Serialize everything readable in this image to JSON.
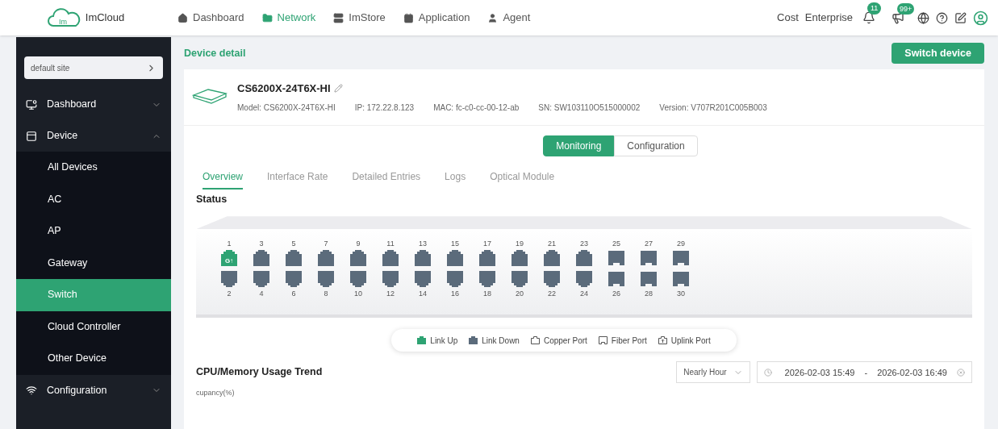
{
  "brand": {
    "name": "ImCloud",
    "logo_text": "Im"
  },
  "top_nav": [
    {
      "label": "Dashboard",
      "selected": false
    },
    {
      "label": "Network",
      "selected": true
    },
    {
      "label": "ImStore",
      "selected": false
    },
    {
      "label": "Application",
      "selected": false
    },
    {
      "label": "Agent",
      "selected": false
    }
  ],
  "top_right": {
    "links": [
      "Cost",
      "Enterprise"
    ],
    "notifications_badge": "11",
    "announcements_badge": "99+"
  },
  "sidebar": {
    "site": "default site",
    "menu": [
      {
        "label": "Dashboard",
        "expanded": false
      },
      {
        "label": "Device",
        "expanded": true,
        "children": [
          {
            "label": "All Devices",
            "selected": false
          },
          {
            "label": "AC",
            "selected": false
          },
          {
            "label": "AP",
            "selected": false
          },
          {
            "label": "Gateway",
            "selected": false
          },
          {
            "label": "Switch",
            "selected": true
          },
          {
            "label": "Cloud Controller",
            "selected": false
          },
          {
            "label": "Other Device",
            "selected": false
          }
        ]
      },
      {
        "label": "Configuration",
        "expanded": false
      }
    ]
  },
  "page": {
    "title": "Device detail",
    "action": "Switch device"
  },
  "device": {
    "name": "CS6200X-24T6X-HI",
    "details": [
      "Model: CS6200X-24T6X-HI",
      "IP: 172.22.8.123",
      "MAC: fc-c0-cc-00-12-ab",
      "SN: SW103110O515000002",
      "Version: V707R201C005B003"
    ]
  },
  "mode_tabs": [
    {
      "label": "Monitoring",
      "selected": true
    },
    {
      "label": "Configuration",
      "selected": false
    }
  ],
  "tabs": [
    {
      "label": "Overview",
      "selected": true
    },
    {
      "label": "Interface Rate",
      "selected": false
    },
    {
      "label": "Detailed Entries",
      "selected": false
    },
    {
      "label": "Logs",
      "selected": false
    },
    {
      "label": "Optical Module",
      "selected": false
    }
  ],
  "status": {
    "title": "Status",
    "ports": [
      {
        "label": "1",
        "kind": "copper",
        "up": true,
        "badge": "G↑"
      },
      {
        "label": "2",
        "kind": "copper",
        "up": false
      },
      {
        "label": "3",
        "kind": "copper",
        "up": false
      },
      {
        "label": "4",
        "kind": "copper",
        "up": false
      },
      {
        "label": "5",
        "kind": "copper",
        "up": false
      },
      {
        "label": "6",
        "kind": "copper",
        "up": false
      },
      {
        "label": "7",
        "kind": "copper",
        "up": false
      },
      {
        "label": "8",
        "kind": "copper",
        "up": false
      },
      {
        "label": "9",
        "kind": "copper",
        "up": false
      },
      {
        "label": "10",
        "kind": "copper",
        "up": false
      },
      {
        "label": "11",
        "kind": "copper",
        "up": false
      },
      {
        "label": "12",
        "kind": "copper",
        "up": false
      },
      {
        "label": "13",
        "kind": "copper",
        "up": false
      },
      {
        "label": "14",
        "kind": "copper",
        "up": false
      },
      {
        "label": "15",
        "kind": "copper",
        "up": false
      },
      {
        "label": "16",
        "kind": "copper",
        "up": false
      },
      {
        "label": "17",
        "kind": "copper",
        "up": false
      },
      {
        "label": "18",
        "kind": "copper",
        "up": false
      },
      {
        "label": "19",
        "kind": "copper",
        "up": false
      },
      {
        "label": "20",
        "kind": "copper",
        "up": false
      },
      {
        "label": "21",
        "kind": "copper",
        "up": false
      },
      {
        "label": "22",
        "kind": "copper",
        "up": false
      },
      {
        "label": "23",
        "kind": "copper",
        "up": false
      },
      {
        "label": "24",
        "kind": "copper",
        "up": false
      },
      {
        "label": "25",
        "kind": "fiber",
        "up": false
      },
      {
        "label": "26",
        "kind": "fiber",
        "up": false
      },
      {
        "label": "27",
        "kind": "fiber",
        "up": false
      },
      {
        "label": "28",
        "kind": "fiber",
        "up": false
      },
      {
        "label": "29",
        "kind": "fiber",
        "up": false
      },
      {
        "label": "30",
        "kind": "fiber",
        "up": false
      }
    ],
    "legend": [
      {
        "label": "Link Up",
        "kind": "link_up"
      },
      {
        "label": "Link Down",
        "kind": "link_down"
      },
      {
        "label": "Copper Port",
        "kind": "copper"
      },
      {
        "label": "Fiber Port",
        "kind": "fiber"
      },
      {
        "label": "Uplink Port",
        "kind": "uplink"
      }
    ]
  },
  "trend": {
    "title": "CPU/Memory Usage Trend",
    "range": "Nearly Hour",
    "start": "2026-02-03 15:49",
    "separator": "-",
    "end": "2026-02-03 16:49",
    "axis_label": "cupancy(%)"
  }
}
